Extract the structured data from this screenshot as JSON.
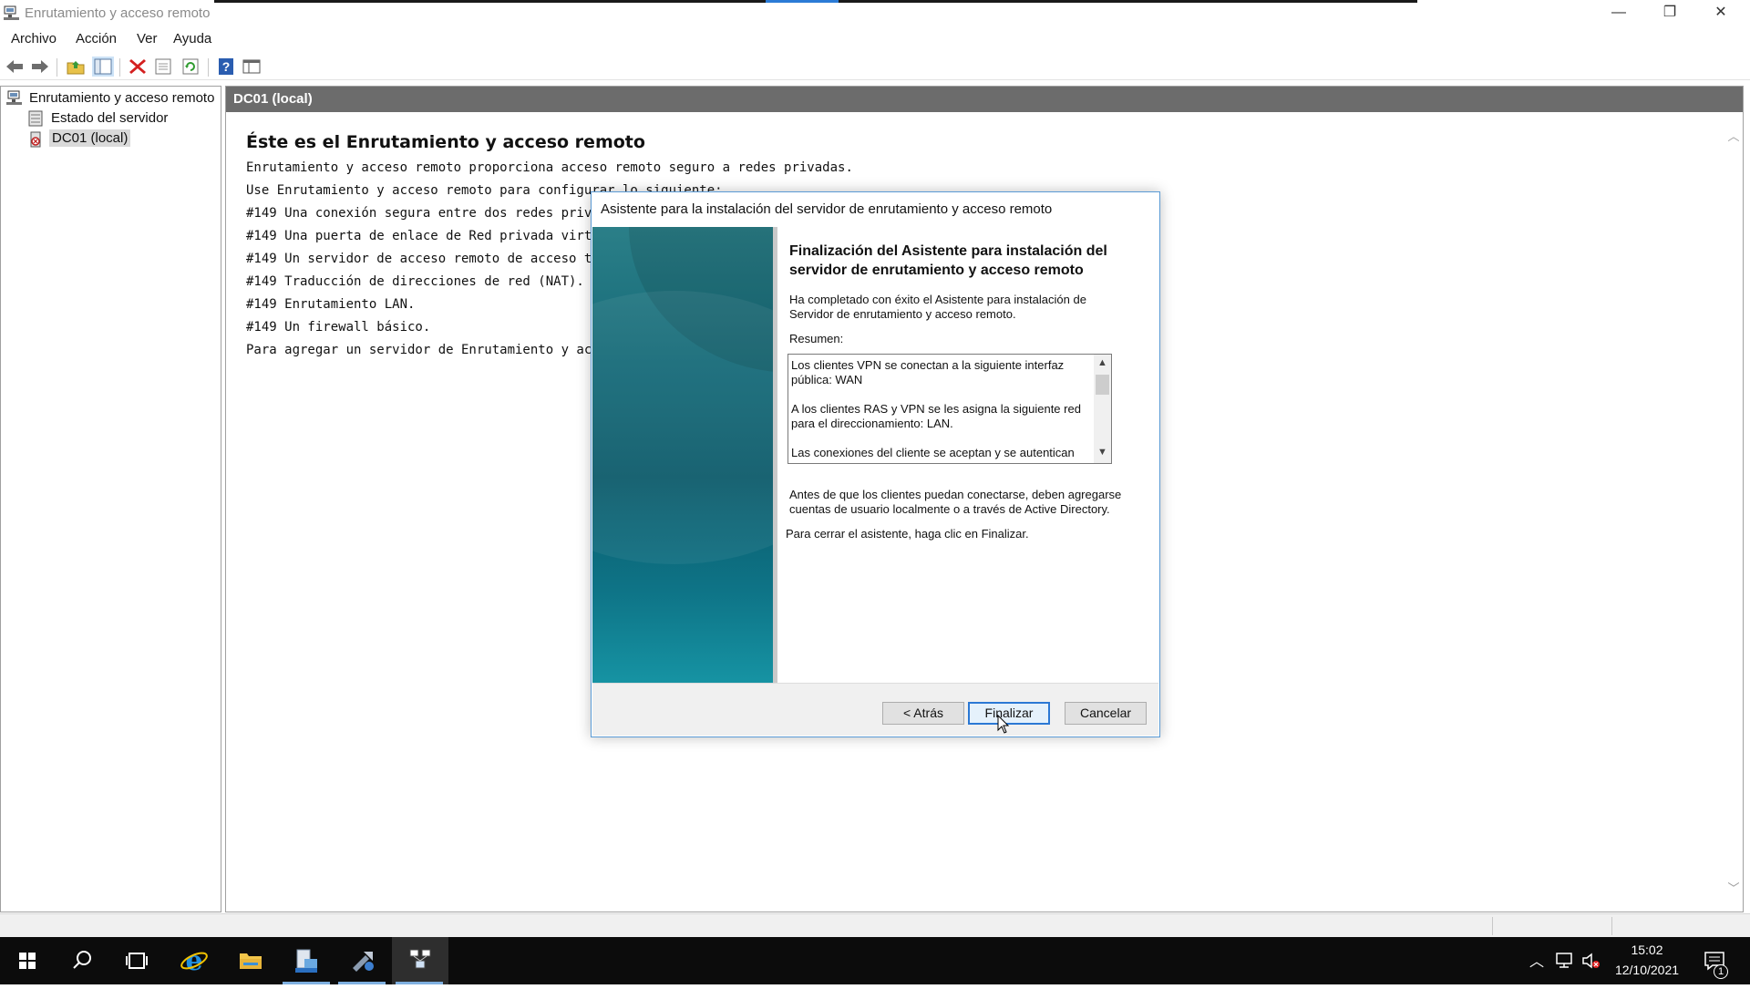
{
  "window": {
    "title": "Enrutamiento y acceso remoto",
    "controls": {
      "minimize": "—",
      "restore": "❐",
      "close": "✕"
    }
  },
  "menu": [
    "Archivo",
    "Acción",
    "Ver",
    "Ayuda"
  ],
  "toolbar": {
    "icons": [
      "back-icon",
      "forward-icon",
      "up-folder-icon",
      "show-hide-tree-icon",
      "delete-icon",
      "properties-icon",
      "refresh-icon",
      "help-icon",
      "console-icon"
    ]
  },
  "tree": {
    "root": "Enrutamiento y acceso remoto",
    "items": [
      "Estado del servidor",
      "DC01 (local)"
    ],
    "selected": "DC01 (local)"
  },
  "main": {
    "header": "DC01 (local)",
    "title": "Éste es el Enrutamiento y acceso remoto",
    "lines": [
      "Enrutamiento y acceso remoto proporciona acceso remoto seguro a redes privadas.",
      "Use Enrutamiento y acceso remoto para configurar lo siguiente:",
      "#149 Una conexión segura entre dos redes privadas",
      "#149 Una puerta de enlace de Red privada virtual (V",
      "#149 Un servidor de acceso remoto de acceso telefó",
      "#149 Traducción de direcciones de red (NAT).",
      "#149 Enrutamiento LAN.",
      "#149 Un firewall básico.",
      "Para agregar un servidor de Enrutamiento y acceso r"
    ]
  },
  "dialog": {
    "title": "Asistente para la instalación del servidor de enrutamiento y acceso remoto",
    "heading": "Finalización del Asistente para instalación del servidor de enrutamiento y acceso remoto",
    "intro": "Ha completado con éxito el Asistente para instalación de Servidor de enrutamiento y acceso remoto.",
    "summary_label": "Resumen:",
    "summary_lines": [
      "Los clientes VPN se conectan a la siguiente interfaz pública: WAN",
      "A los clientes RAS y VPN se les asigna la siguiente red para el direccionamiento: LAN.",
      "Las conexiones del cliente se aceptan y se autentican"
    ],
    "note": "Antes de que los clientes puedan conectarse, deben agregarse cuentas de usuario localmente o a través de Active Directory.",
    "close_hint": "Para cerrar el asistente, haga clic en Finalizar.",
    "buttons": {
      "back": "< Atrás",
      "finish": "Finalizar",
      "cancel": "Cancelar"
    }
  },
  "taskbar": {
    "apps": [
      "start-icon",
      "search-icon",
      "task-view-icon",
      "internet-explorer-icon",
      "file-explorer-icon",
      "server-manager-icon",
      "tools-icon",
      "routing-remote-access-icon"
    ],
    "active_app": "routing-remote-access-icon",
    "time": "15:02",
    "date": "12/10/2021",
    "notification_count": "1"
  }
}
